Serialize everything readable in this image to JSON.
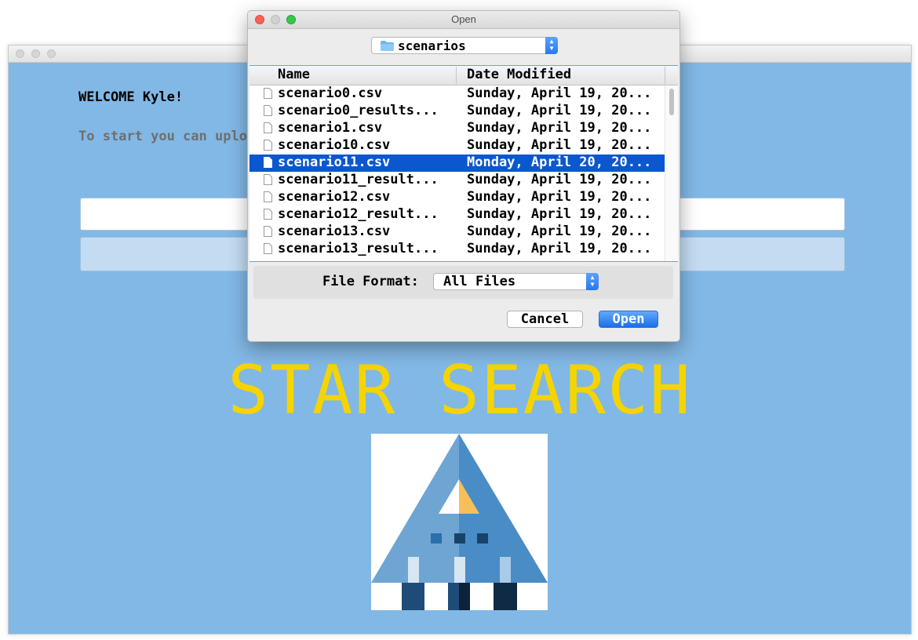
{
  "app": {
    "welcome": "WELCOME Kyle!",
    "instructions": "To start you can upload a new simulation or resume a previous sim...",
    "title": "STAR SEARCH"
  },
  "dialog": {
    "title": "Open",
    "folder": "scenarios",
    "columns": {
      "name": "Name",
      "date": "Date Modified"
    },
    "files": [
      {
        "name": "scenario0.csv",
        "date": "Sunday, April 19, 20..."
      },
      {
        "name": "scenario0_results...",
        "date": "Sunday, April 19, 20..."
      },
      {
        "name": "scenario1.csv",
        "date": "Sunday, April 19, 20..."
      },
      {
        "name": "scenario10.csv",
        "date": "Sunday, April 19, 20..."
      },
      {
        "name": "scenario11.csv",
        "date": "Monday, April 20, 20...",
        "selected": true
      },
      {
        "name": "scenario11_result...",
        "date": "Sunday, April 19, 20..."
      },
      {
        "name": "scenario12.csv",
        "date": "Sunday, April 19, 20..."
      },
      {
        "name": "scenario12_result...",
        "date": "Sunday, April 19, 20..."
      },
      {
        "name": "scenario13.csv",
        "date": "Sunday, April 19, 20..."
      },
      {
        "name": "scenario13_result...",
        "date": "Sunday, April 19, 20..."
      }
    ],
    "format_label": "File Format:",
    "format_value": "All Files",
    "cancel_label": "Cancel",
    "open_label": "Open"
  },
  "colors": {
    "app_background": "#82b8e5",
    "title_yellow": "#f5d400",
    "selection_blue": "#0b57d0",
    "button_blue": "#1b6fe8"
  },
  "icons": {
    "folder": "folder-icon",
    "document": "document-icon",
    "popup_arrows": "chevron-updown-icon"
  }
}
